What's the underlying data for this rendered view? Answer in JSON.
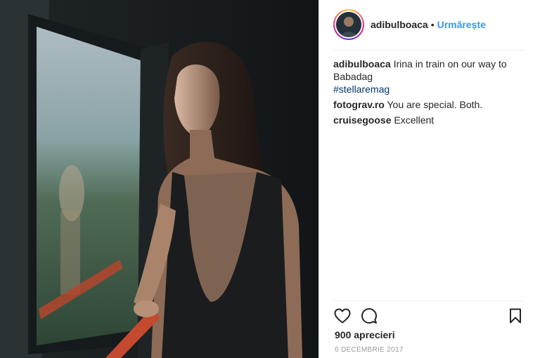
{
  "post": {
    "author": {
      "username": "adibulboaca",
      "separator": "•",
      "follow_label": "Urmărește",
      "avatar_icon": "profile-photo"
    },
    "caption": {
      "author": "adibulboaca",
      "text": "Irina in train on our way to Babadag",
      "hashtag": "#stellaremag"
    },
    "comments": [
      {
        "author": "fotograv.ro",
        "text": "You are special. Both."
      },
      {
        "author": "cruisegoose",
        "text": "Excellent"
      }
    ],
    "actions": {
      "like_icon": "heart-icon",
      "comment_icon": "comment-icon",
      "save_icon": "bookmark-icon"
    },
    "likes_text": "900 aprecieri",
    "date_text": "6 DECEMBRIE 2017"
  },
  "colors": {
    "link": "#3897f0",
    "hashtag": "#003569",
    "text": "#262626",
    "muted": "#999999",
    "divider": "#efefef"
  }
}
